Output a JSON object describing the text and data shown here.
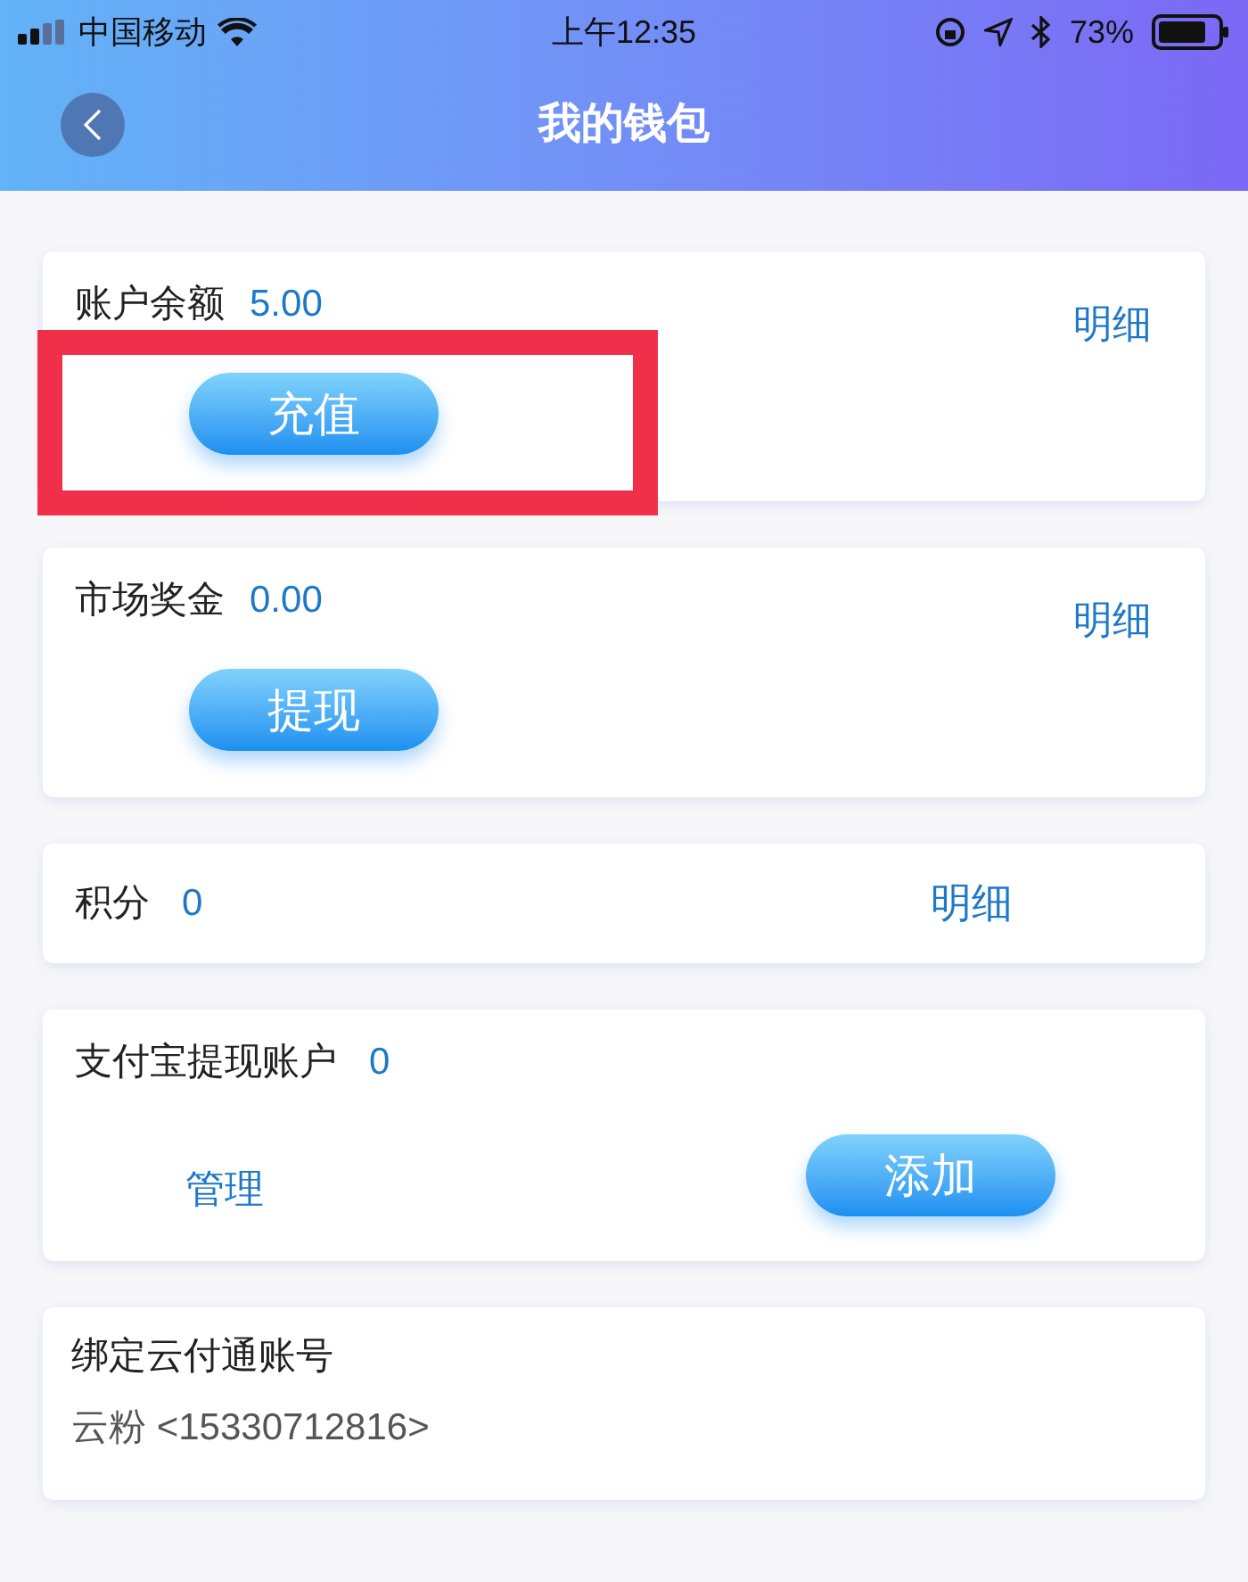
{
  "status_bar": {
    "carrier": "中国移动",
    "time": "上午12:35",
    "battery": "73%"
  },
  "nav": {
    "title": "我的钱包"
  },
  "cards": [
    {
      "kind": "balance",
      "label": "账户余额",
      "value": "5.00",
      "link": "明细",
      "button": "充值",
      "highlighted": true
    },
    {
      "kind": "balance",
      "label": "市场奖金",
      "value": "0.00",
      "link": "明细",
      "button": "提现",
      "highlighted": false
    },
    {
      "kind": "points",
      "label": "积分",
      "value": "0",
      "link": "明细"
    },
    {
      "kind": "account",
      "label": "支付宝提现账户",
      "value": "0",
      "link": "管理",
      "button": "添加"
    },
    {
      "kind": "bound",
      "label": "绑定云付通账号",
      "detail": "云粉 <15330712816>"
    }
  ]
}
